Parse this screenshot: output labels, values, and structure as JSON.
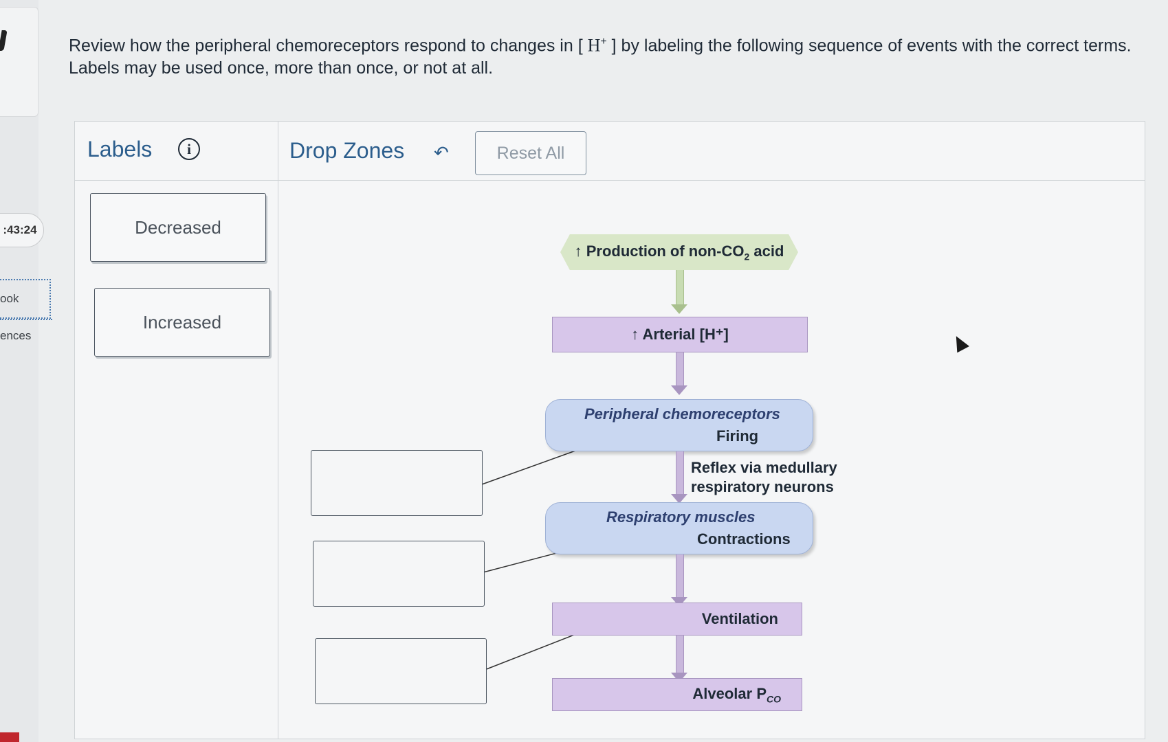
{
  "sidebar": {
    "timer": ":43:24",
    "ebook_label": "ook",
    "references_label": "ences"
  },
  "question": {
    "text_before": "Review how the peripheral chemoreceptors respond to changes in [ ",
    "ion": "H",
    "ion_charge": "+",
    "text_after": " ] by labeling the following sequence of events with the correct terms. Labels may be used once, more than once, or not at all."
  },
  "panel": {
    "labels_title": "Labels",
    "info_icon": "info-icon",
    "drop_zones_title": "Drop Zones",
    "undo_icon": "↶",
    "reset_label": "Reset All"
  },
  "labels": [
    {
      "text": "Decreased"
    },
    {
      "text": "Increased"
    }
  ],
  "diagram": {
    "production": {
      "arrow": "↑",
      "text": "Production of non-CO",
      "sub": "2",
      "after": " acid"
    },
    "arterial": "↑ Arterial [H⁺]",
    "chemoreceptors": {
      "title": "Peripheral chemoreceptors",
      "sub": "Firing"
    },
    "reflex": {
      "line1": "Reflex via medullary",
      "line2": "respiratory neurons"
    },
    "muscles": {
      "title": "Respiratory muscles",
      "sub": "Contractions"
    },
    "ventilation": "Ventilation",
    "alveolar": "Alveolar P",
    "alveolar_sub": "CO"
  },
  "drop_zones": [
    {
      "value": ""
    },
    {
      "value": ""
    },
    {
      "value": ""
    }
  ]
}
